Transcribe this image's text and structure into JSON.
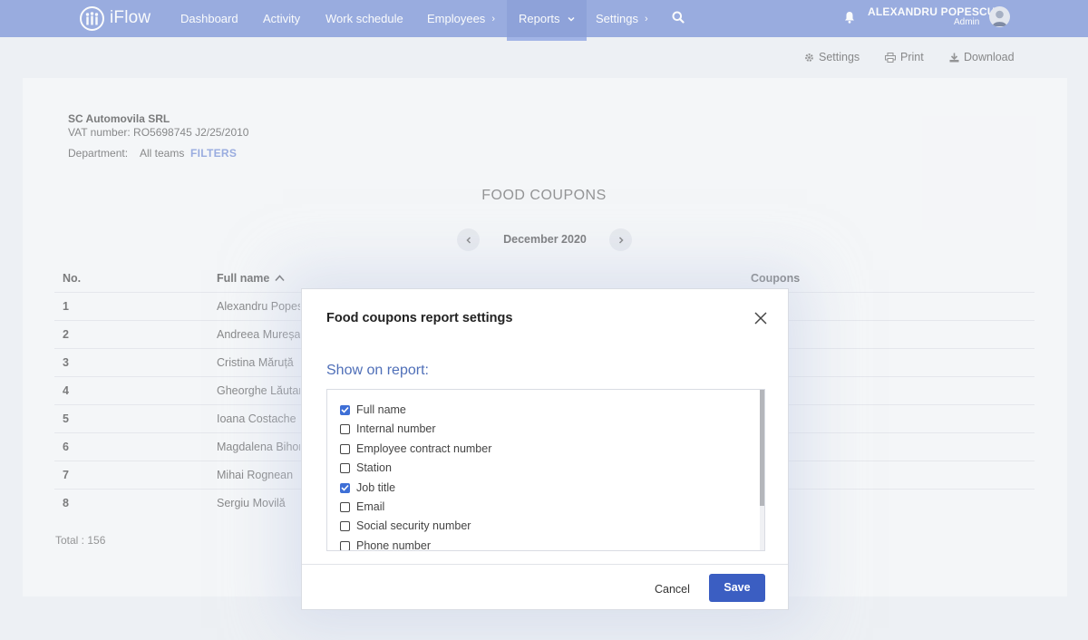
{
  "nav": {
    "brand": "iFlow",
    "items": [
      {
        "label": "Dashboard"
      },
      {
        "label": "Activity"
      },
      {
        "label": "Work schedule"
      },
      {
        "label": "Employees"
      },
      {
        "label": "Reports"
      },
      {
        "label": "Settings"
      }
    ],
    "user_name": "ALEXANDRU POPESCU",
    "user_role": "Admin"
  },
  "toolbar": {
    "settings": "Settings",
    "print": "Print",
    "download": "Download"
  },
  "report": {
    "company": "SC Automovila SRL",
    "vat": "VAT number: RO5698745 J2/25/2010",
    "department_label": "Department:",
    "department_value": "All teams",
    "filters": "FILTERS",
    "title": "FOOD COUPONS",
    "month": "December 2020",
    "col_no": "No.",
    "col_name": "Full name",
    "col_coupons": "Coupons",
    "rows": [
      {
        "no": "1",
        "name": "Alexandru Popescu"
      },
      {
        "no": "2",
        "name": "Andreea Mureșan"
      },
      {
        "no": "3",
        "name": "Cristina Măruță"
      },
      {
        "no": "4",
        "name": "Gheorghe Lăutaru"
      },
      {
        "no": "5",
        "name": "Ioana Costache"
      },
      {
        "no": "6",
        "name": "Magdalena Bihor"
      },
      {
        "no": "7",
        "name": "Mihai Rognean"
      },
      {
        "no": "8",
        "name": "Sergiu Movilă"
      }
    ],
    "total": "Total : 156"
  },
  "modal": {
    "title": "Food coupons report settings",
    "show_label": "Show on report:",
    "options": [
      {
        "label": "Full name",
        "checked": true
      },
      {
        "label": "Internal number",
        "checked": false
      },
      {
        "label": "Employee contract number",
        "checked": false
      },
      {
        "label": "Station",
        "checked": false
      },
      {
        "label": "Job title",
        "checked": true
      },
      {
        "label": "Email",
        "checked": false
      },
      {
        "label": "Social security number",
        "checked": false
      },
      {
        "label": "Phone number",
        "checked": false
      }
    ],
    "cancel": "Cancel",
    "save": "Save"
  },
  "colors": {
    "nav_bg": "#7e96d8",
    "accent": "#3b5ec2",
    "link": "#7e96d8"
  }
}
